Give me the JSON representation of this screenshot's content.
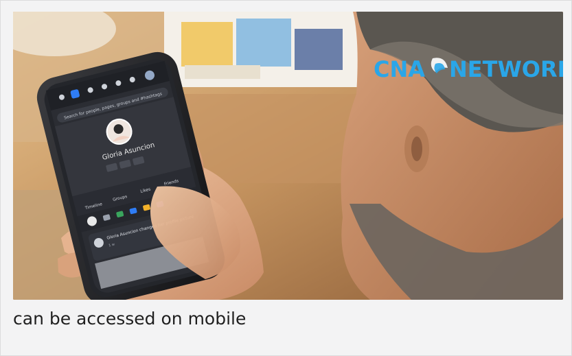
{
  "caption": "can be accessed on mobile",
  "logo": {
    "text_left": "CNA",
    "text_right": "NETWORK",
    "color": "#2aa6e8"
  },
  "phone": {
    "search_placeholder": "Search for people, pages, groups and #hashtags",
    "profile_name": "Gloria Asuncion",
    "tabs": [
      "Timeline",
      "Groups",
      "Likes",
      "Friends"
    ],
    "feed_item": {
      "text": "Gloria Asuncion changed her profile picture",
      "time": "1 w"
    }
  }
}
